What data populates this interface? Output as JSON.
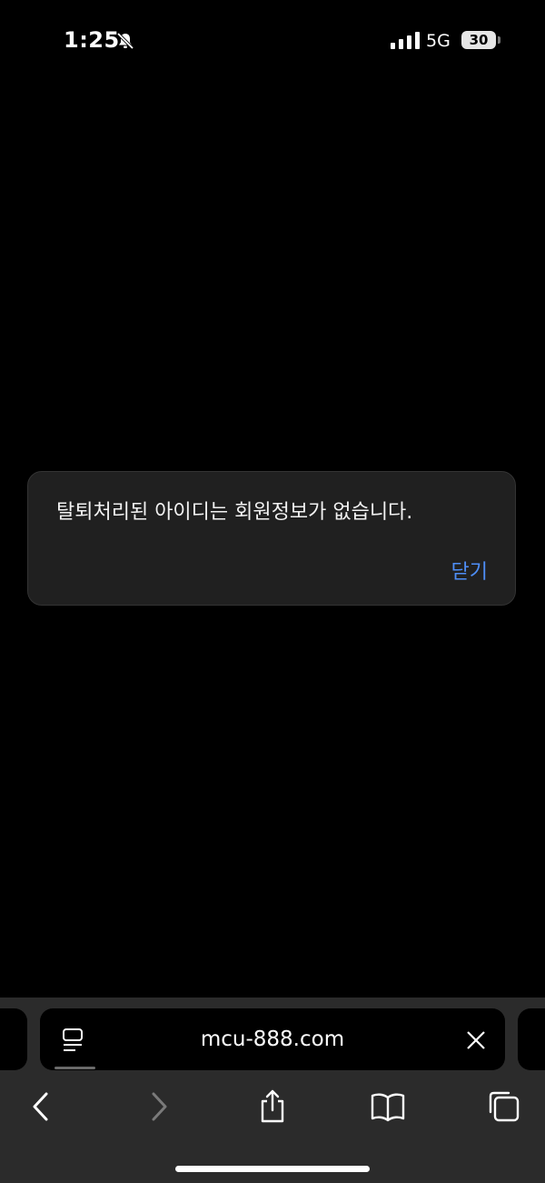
{
  "status_bar": {
    "time": "1:25",
    "network": "5G",
    "battery": "30",
    "icons": [
      "bell-slash-icon",
      "cellular-signal-icon",
      "battery-icon"
    ]
  },
  "alert": {
    "message": "탈퇴처리된 아이디는 회원정보가 없습니다.",
    "close_label": "닫기",
    "accent_color": "#4e8ef7"
  },
  "browser": {
    "url": "mcu-888.com",
    "address_icons": [
      "page-menu-icon",
      "clear-url-icon"
    ],
    "toolbar_icons": [
      "back-icon",
      "forward-icon",
      "share-icon",
      "bookmarks-icon",
      "tabs-icon"
    ]
  }
}
